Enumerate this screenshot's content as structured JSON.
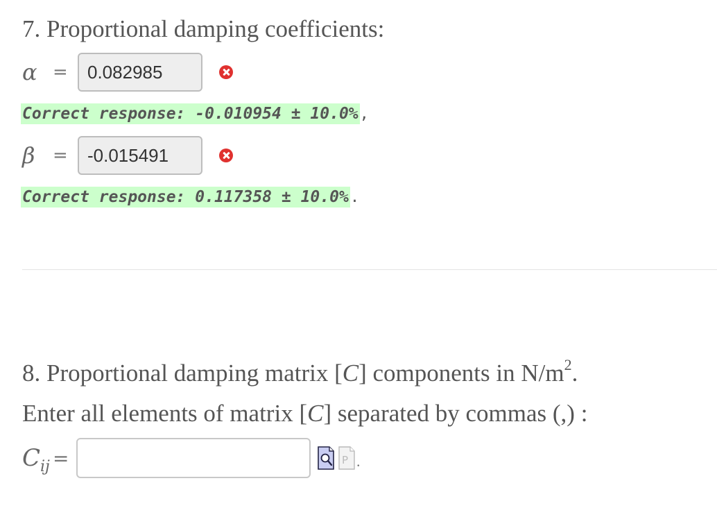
{
  "q7": {
    "number": "7.",
    "title": "Proportional damping coefficients:",
    "alpha": {
      "symbol": "α",
      "equals": "=",
      "value": "0.082985",
      "correct_text": "Correct response: -0.010954 ± 10.0%",
      "trailing": ","
    },
    "beta": {
      "symbol": "β",
      "equals": "=",
      "value": "-0.015491",
      "correct_text": "Correct response: 0.117358 ± 10.0%",
      "trailing": "."
    }
  },
  "q8": {
    "title_prefix": "8. Proportional damping matrix [",
    "title_var": "C",
    "title_mid": "] components in N/m",
    "title_sup": "2",
    "title_suffix": ".",
    "instr_prefix": "Enter all elements of matrix [",
    "instr_var": "C",
    "instr_suffix": "] separated by commas (,) :",
    "input_label_var": "C",
    "input_label_sub": "ij",
    "equals": "=",
    "input_value": "",
    "trailing": "."
  },
  "icons": {
    "incorrect": "x-circle-icon",
    "preview": "magnifier-preview-icon",
    "preview_text": "text-preview-icon"
  },
  "colors": {
    "incorrect": "#e0312f",
    "correct_highlight": "#ccffcc"
  }
}
